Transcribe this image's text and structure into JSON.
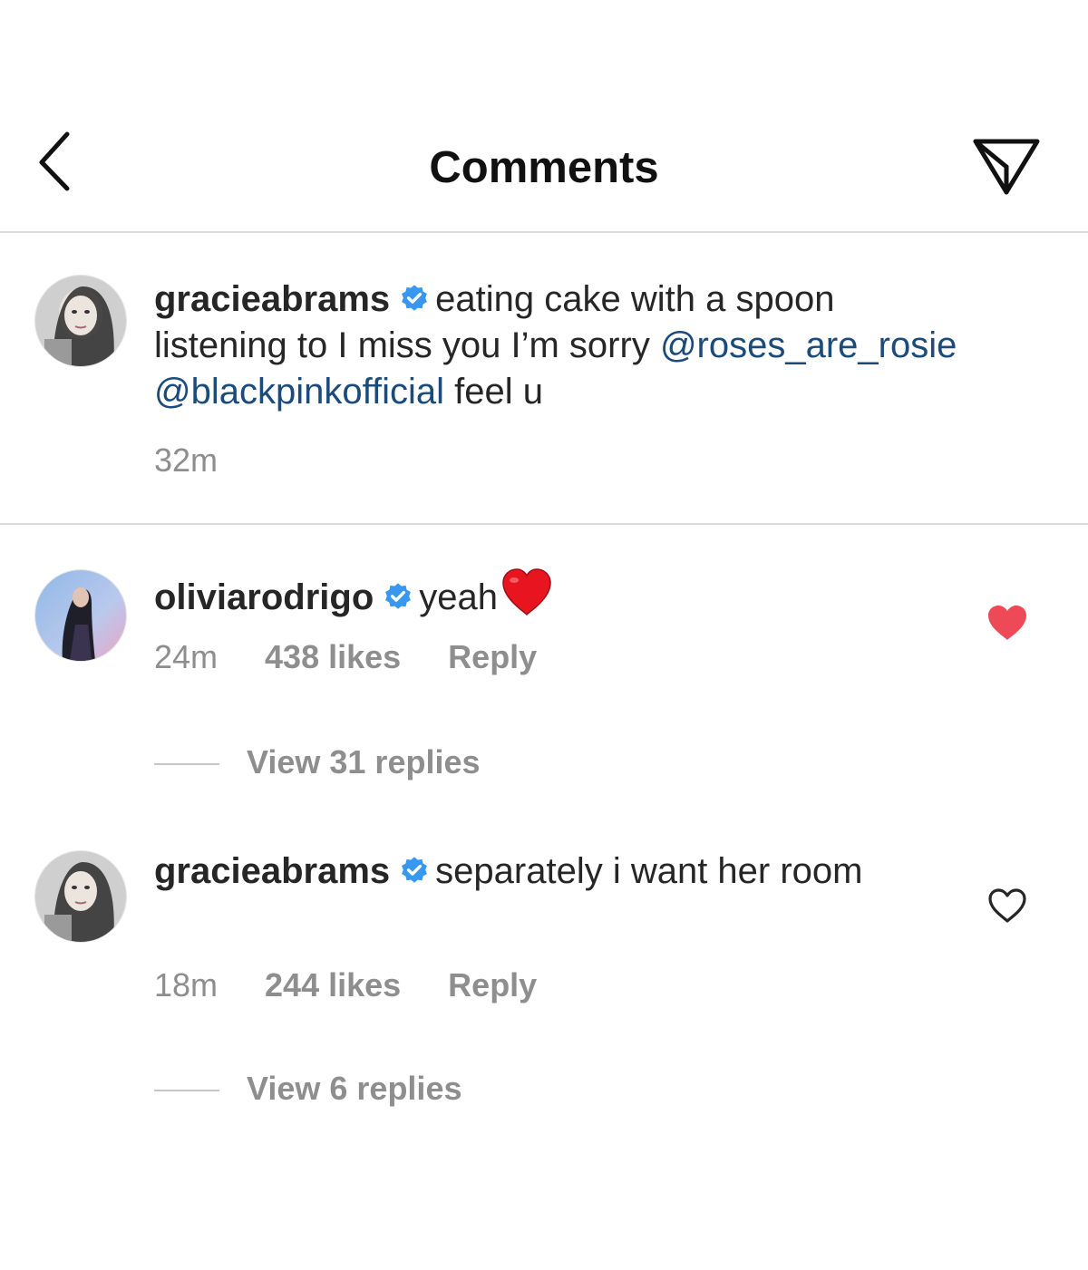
{
  "header": {
    "title": "Comments",
    "back_icon": "chevron-left-icon",
    "send_icon": "paper-plane-icon"
  },
  "caption": {
    "username": "gracieabrams",
    "text_part1": "eating cake with a spoon listening to I miss you I’m sorry",
    "mention1": "@roses_are_rosie",
    "mention2": "@blackpinkofficial",
    "text_part2": "feel u",
    "time": "32m"
  },
  "comments": [
    {
      "username": "oliviarodrigo",
      "text": "yeah",
      "emoji": "red-heart-emoji",
      "time": "24m",
      "likes": "438 likes",
      "reply": "Reply",
      "liked": true,
      "view_replies": "View 31 replies"
    },
    {
      "username": "gracieabrams",
      "text": "separately i want her room",
      "time": "18m",
      "likes": "244 likes",
      "reply": "Reply",
      "liked": false,
      "view_replies": "View 6 replies"
    }
  ],
  "colors": {
    "mention": "#1b4b7a",
    "verified": "#3897f0",
    "liked_heart": "#ed4956",
    "secondary_text": "#8e8e8e",
    "divider": "#dbdbdb"
  }
}
